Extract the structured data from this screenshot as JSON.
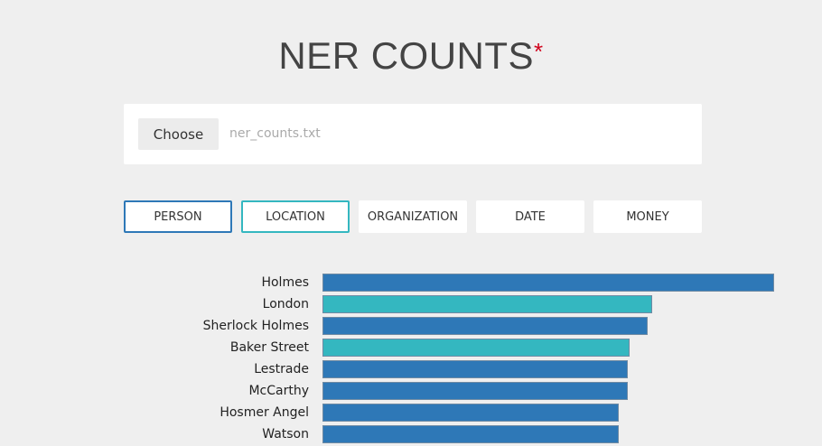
{
  "header": {
    "title": "NER COUNTS",
    "asterisk": "*"
  },
  "file": {
    "choose_label": "Choose",
    "file_name": "ner_counts.txt"
  },
  "filters": [
    {
      "label": "PERSON",
      "state": "active",
      "color": "#2e78b7"
    },
    {
      "label": "LOCATION",
      "state": "active",
      "color": "#34b7c0"
    },
    {
      "label": "ORGANIZATION",
      "state": "inactive"
    },
    {
      "label": "DATE",
      "state": "inactive"
    },
    {
      "label": "MONEY",
      "state": "inactive"
    }
  ],
  "colors": {
    "person": "#2e78b7",
    "location": "#34b7c0",
    "background": "#efefef"
  },
  "chart_data": {
    "type": "bar",
    "orientation": "horizontal",
    "categories": [
      "Holmes",
      "London",
      "Sherlock Holmes",
      "Baker Street",
      "Lestrade",
      "McCarthy",
      "Hosmer Angel",
      "Watson"
    ],
    "values": [
      100,
      73,
      72,
      68,
      67.5,
      67.5,
      65.5,
      65.5
    ],
    "entity_types": [
      "PERSON",
      "LOCATION",
      "PERSON",
      "LOCATION",
      "PERSON",
      "PERSON",
      "PERSON",
      "PERSON"
    ],
    "xlim": [
      0,
      100
    ]
  }
}
